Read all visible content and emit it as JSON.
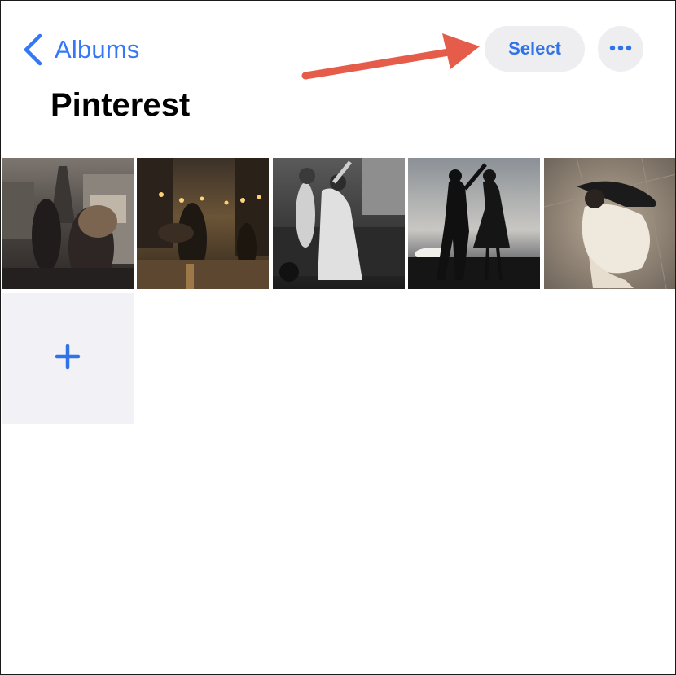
{
  "nav": {
    "back_label": "Albums",
    "select_label": "Select",
    "more_icon": "ellipsis-icon",
    "accent_color": "#3478f6"
  },
  "album": {
    "title": "Pinterest",
    "photos": [
      {
        "name": "photo-couple-paris-street"
      },
      {
        "name": "photo-couple-dip-rainy-street"
      },
      {
        "name": "photo-couple-dancing-bw"
      },
      {
        "name": "photo-couple-silhouette-sunset"
      },
      {
        "name": "photo-couple-dancing-overhead"
      }
    ],
    "add_icon": "plus-icon"
  },
  "annotation": {
    "arrow_color": "#e65c4a"
  }
}
